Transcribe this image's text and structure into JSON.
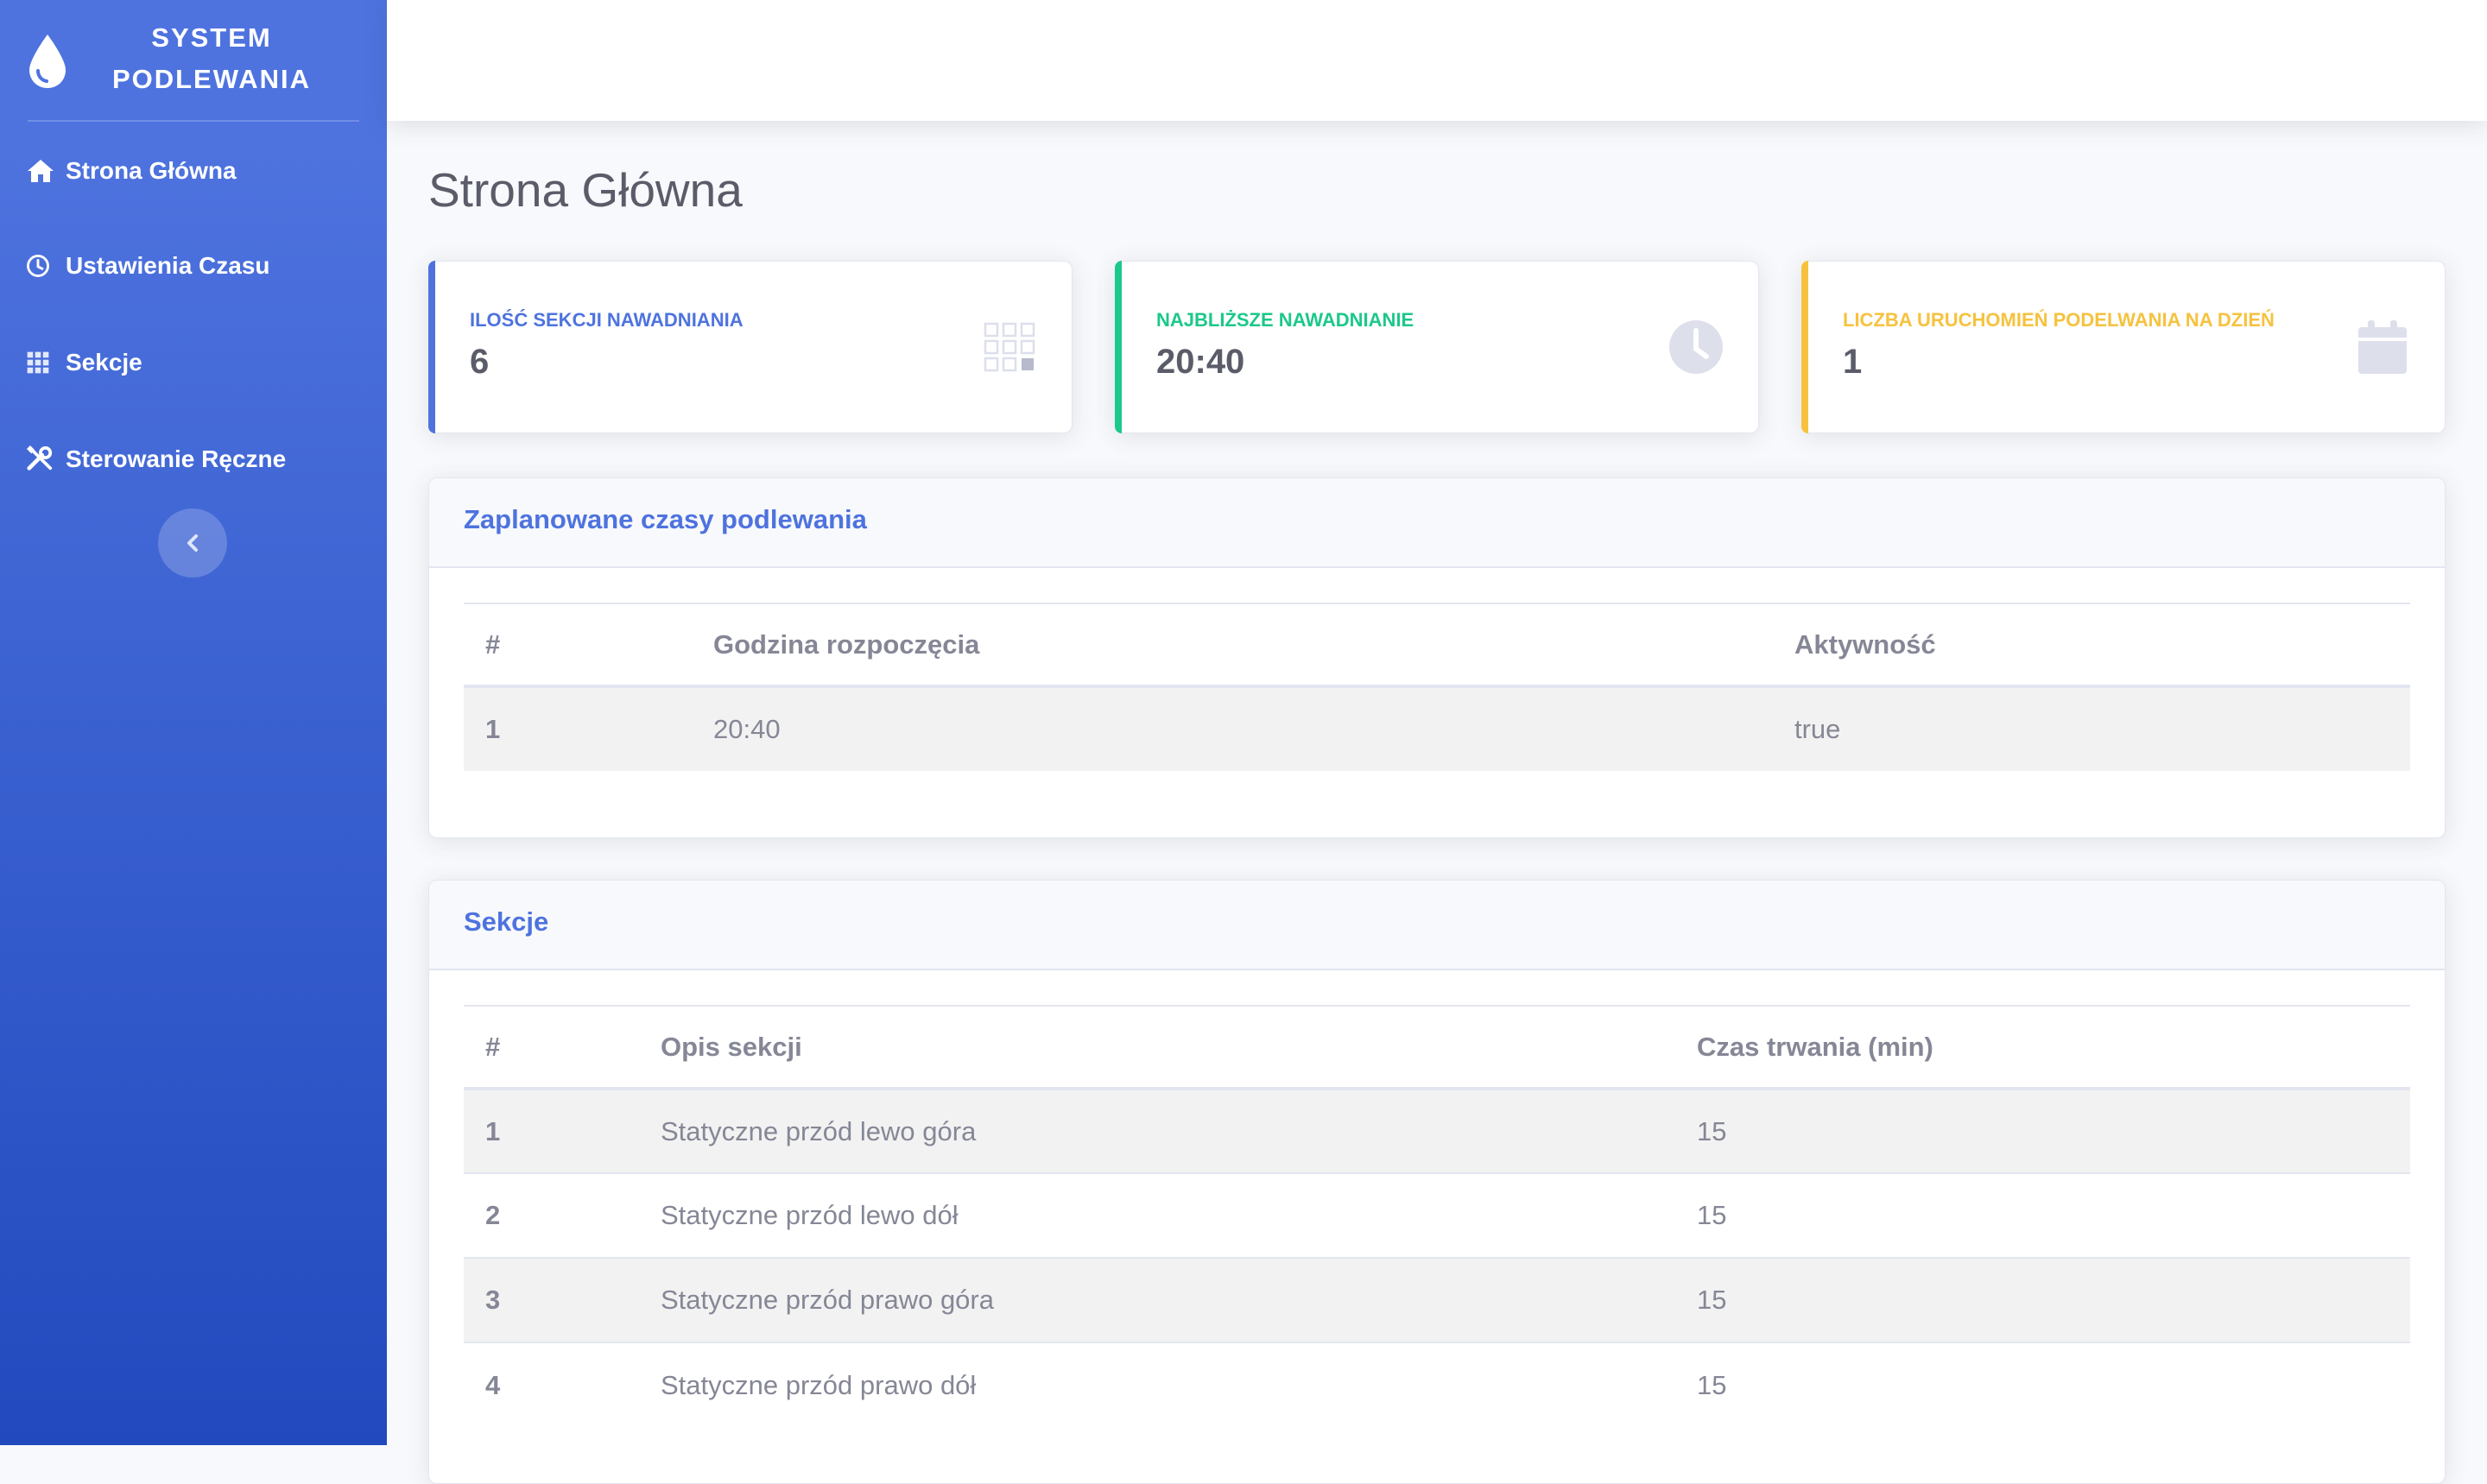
{
  "brand": {
    "title": "System Podlewania",
    "icon": "water-drop-icon"
  },
  "sidebar": {
    "items": [
      {
        "label": "Strona Główna",
        "icon": "home-icon"
      },
      {
        "label": "Ustawienia Czasu",
        "icon": "clock-icon"
      },
      {
        "label": "Sekcje",
        "icon": "grid-icon"
      },
      {
        "label": "Sterowanie Ręczne",
        "icon": "tools-icon"
      }
    ],
    "toggle_icon": "chevron-left-icon"
  },
  "page": {
    "title": "Strona Główna"
  },
  "stats": [
    {
      "label": "Ilość sekcji nawadniania",
      "value": "6",
      "color": "#4e73df",
      "icon": "grid-icon"
    },
    {
      "label": "Najbliższe nawadnianie",
      "value": "20:40",
      "color": "#1cc88a",
      "icon": "clock-icon"
    },
    {
      "label": "Liczba uruchomień podelwania na dzień",
      "value": "1",
      "color": "#f6c23e",
      "icon": "calendar-icon"
    }
  ],
  "schedule": {
    "title": "Zaplanowane czasy podlewania",
    "headers": [
      "#",
      "Godzina rozpoczęcia",
      "Aktywność"
    ],
    "rows": [
      [
        "1",
        "20:40",
        "true"
      ]
    ]
  },
  "sections": {
    "title": "Sekcje",
    "headers": [
      "#",
      "Opis sekcji",
      "Czas trwania (min)"
    ],
    "rows": [
      [
        "1",
        "Statyczne przód lewo góra",
        "15"
      ],
      [
        "2",
        "Statyczne przód lewo dół",
        "15"
      ],
      [
        "3",
        "Statyczne przód prawo góra",
        "15"
      ],
      [
        "4",
        "Statyczne przód prawo dół",
        "15"
      ]
    ]
  }
}
